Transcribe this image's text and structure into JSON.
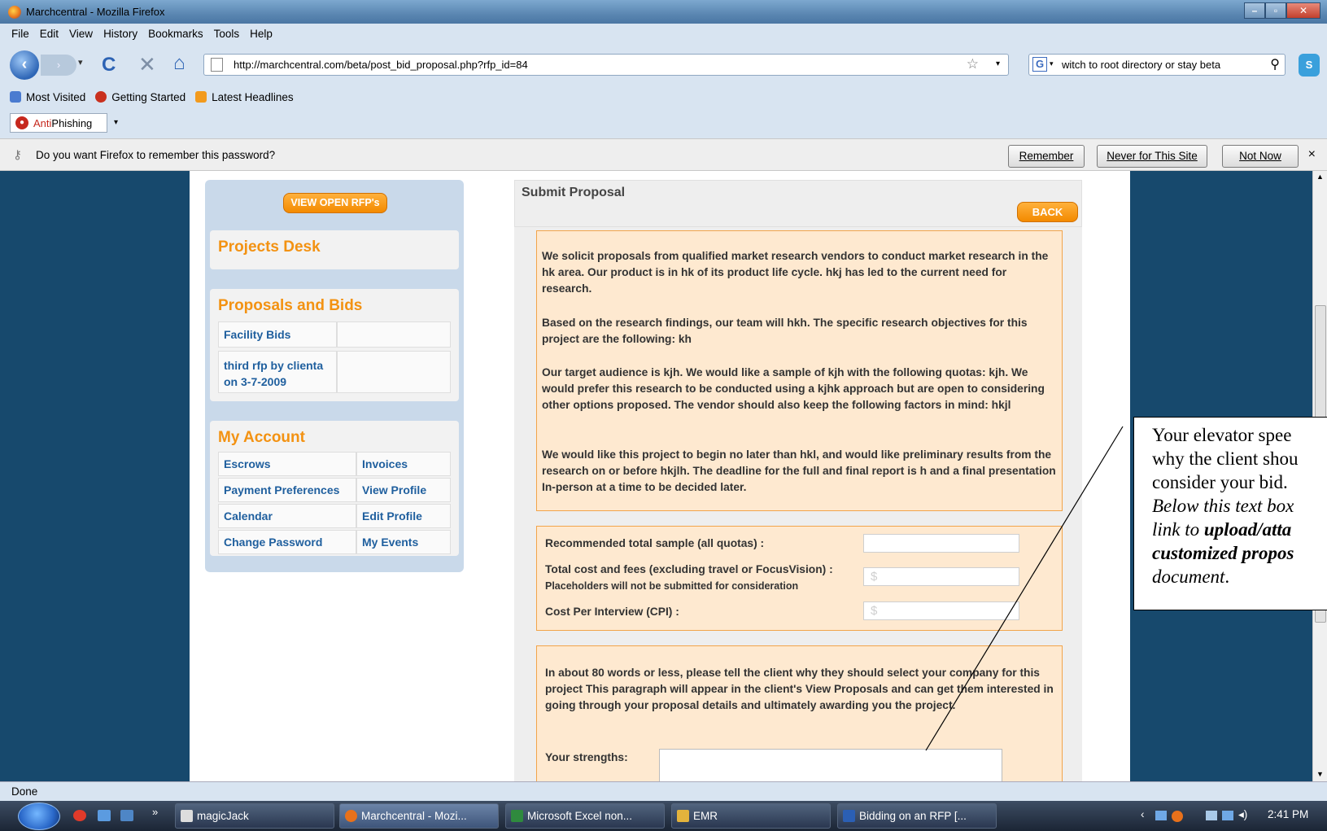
{
  "window": {
    "title": "Marchcentral - Mozilla Firefox"
  },
  "menu": [
    "File",
    "Edit",
    "View",
    "History",
    "Bookmarks",
    "Tools",
    "Help"
  ],
  "nav": {
    "url": "http://marchcentral.com/beta/post_bid_proposal.php?rfp_id=84",
    "search_value": "witch to root directory or stay beta"
  },
  "bookmarks": [
    "Most Visited",
    "Getting Started",
    "Latest Headlines"
  ],
  "antiphishing": {
    "part1": "Anti",
    "part2": "Phishing"
  },
  "password_bar": {
    "message": "Do you want Firefox to remember this password?",
    "remember": "Remember",
    "never": "Never for This Site",
    "not_now": "Not Now",
    "close": "×"
  },
  "sidebar": {
    "view_open_rfps": "VIEW OPEN RFP's",
    "projects_desk": "Projects Desk",
    "proposals_head": "Proposals and Bids",
    "proposals": [
      "Facility Bids",
      "third rfp by clienta on 3-7-2009"
    ],
    "account_head": "My Account",
    "account_links": [
      [
        "Escrows",
        "Invoices"
      ],
      [
        "Payment Preferences",
        "View Profile"
      ],
      [
        "Calendar",
        "Edit Profile"
      ],
      [
        "Change Password",
        "My Events"
      ]
    ]
  },
  "main": {
    "title": "Submit Proposal",
    "back": "BACK",
    "rfp_paragraphs": [
      "We solicit proposals from qualified market research vendors to conduct market research in the hk area. Our product is in hk of its product life cycle. hkj has led to the current need for research.",
      "Based on the research findings, our team will hkh. The specific research objectives for this project are the following: kh",
      "Our target audience is kjh. We would like a sample of kjh with the following quotas: kjh. We would prefer this research to be conducted using a kjhk approach but are open to considering other options proposed. The vendor should also keep the following factors in mind: hkjl",
      "We would like this project to begin no later than hkl, and would like preliminary results from the research on or before hkjlh. The deadline for the full and final report is h and a final presentation In-person at a time to be decided later."
    ],
    "fields": {
      "sample_label": "Recommended total sample (all quotas) :",
      "cost_label": "Total cost and fees (excluding travel or FocusVision) :",
      "cost_note": "Placeholders will not be submitted for consideration",
      "cost_placeholder": "$",
      "cpi_label": "Cost Per Interview (CPI) :",
      "cpi_placeholder": "$"
    },
    "pitch_text": "In about 80 words or less, please tell the client why they should select your company for this project This paragraph will appear in the client's View Proposals and can get them interested in going through your proposal details and ultimately awarding you the project.",
    "strengths_label": "Your strengths:"
  },
  "callout": {
    "line1": "Your elevator spee",
    "line2": "why the client shou",
    "line3": "consider your bid.",
    "line4": "Below this text box",
    "line5_a": "link to ",
    "line5_b": "upload/atta",
    "line6": "customized propos",
    "line7": "document",
    "line7_end": "."
  },
  "status": "Done",
  "taskbar": {
    "items": [
      "magicJack",
      "Marchcentral - Mozi...",
      "Microsoft Excel non...",
      "EMR",
      "Bidding on an RFP [..."
    ],
    "clock": "2:41 PM"
  }
}
